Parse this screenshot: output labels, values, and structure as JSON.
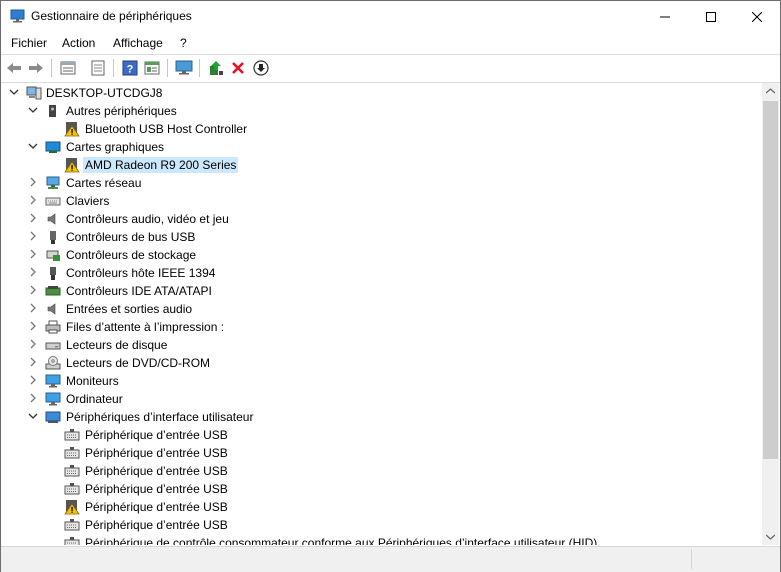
{
  "window": {
    "title": "Gestionnaire de périphériques"
  },
  "menu": [
    "Fichier",
    "Action",
    "Affichage",
    "?"
  ],
  "tree": {
    "root": "DESKTOP-UTCDGJ8",
    "nodes": [
      {
        "label": "Autres périphériques",
        "expanded": true,
        "icon": "unknown-device-icon"
      },
      {
        "label": "Bluetooth USB Host Controller",
        "child": true,
        "icon": "warning-device-icon"
      },
      {
        "label": "Cartes graphiques",
        "expanded": true,
        "icon": "display-adapter-icon"
      },
      {
        "label": "AMD Radeon R9 200 Series",
        "child": true,
        "icon": "warning-device-icon",
        "selected": true
      },
      {
        "label": "Cartes réseau",
        "icon": "network-icon"
      },
      {
        "label": "Claviers",
        "icon": "keyboard-icon"
      },
      {
        "label": "Contrôleurs audio, vidéo et jeu",
        "icon": "speaker-icon"
      },
      {
        "label": "Contrôleurs de bus USB",
        "icon": "usb-icon"
      },
      {
        "label": "Contrôleurs de stockage",
        "icon": "storage-icon"
      },
      {
        "label": "Contrôleurs hôte IEEE 1394",
        "icon": "firewire-icon"
      },
      {
        "label": "Contrôleurs IDE ATA/ATAPI",
        "icon": "ide-icon"
      },
      {
        "label": "Entrées et sorties audio",
        "icon": "speaker-icon"
      },
      {
        "label": "Files d’attente à l’impression :",
        "icon": "printer-icon"
      },
      {
        "label": "Lecteurs de disque",
        "icon": "disk-icon"
      },
      {
        "label": "Lecteurs de DVD/CD-ROM",
        "icon": "dvd-icon"
      },
      {
        "label": "Moniteurs",
        "icon": "monitor-icon"
      },
      {
        "label": "Ordinateur",
        "icon": "computer-icon"
      },
      {
        "label": "Périphériques d’interface utilisateur",
        "expanded": true,
        "icon": "hid-icon"
      },
      {
        "label": "Périphérique d’entrée USB",
        "child": true,
        "icon": "hid-device-icon"
      },
      {
        "label": "Périphérique d’entrée USB",
        "child": true,
        "icon": "hid-device-icon"
      },
      {
        "label": "Périphérique d’entrée USB",
        "child": true,
        "icon": "hid-device-icon"
      },
      {
        "label": "Périphérique d’entrée USB",
        "child": true,
        "icon": "hid-device-icon"
      },
      {
        "label": "Périphérique d’entrée USB",
        "child": true,
        "icon": "warning-device-icon"
      },
      {
        "label": "Périphérique d’entrée USB",
        "child": true,
        "icon": "hid-device-icon"
      },
      {
        "label": "Périphérique de contrôle consommateur conforme aux Périphériques d’interface utilisateur (HID)",
        "child": true,
        "icon": "hid-device-icon"
      }
    ]
  },
  "toolbar": {
    "buttons": [
      "back-icon",
      "forward-icon",
      "properties-view-icon",
      "show-hidden-icon",
      "help-icon",
      "details-icon",
      "scan-hardware-icon",
      "update-driver-icon",
      "uninstall-icon",
      "disable-icon"
    ]
  },
  "colors": {
    "selection": "#cce8ff",
    "warning": "#f5c400",
    "uninstall": "#e81123"
  }
}
